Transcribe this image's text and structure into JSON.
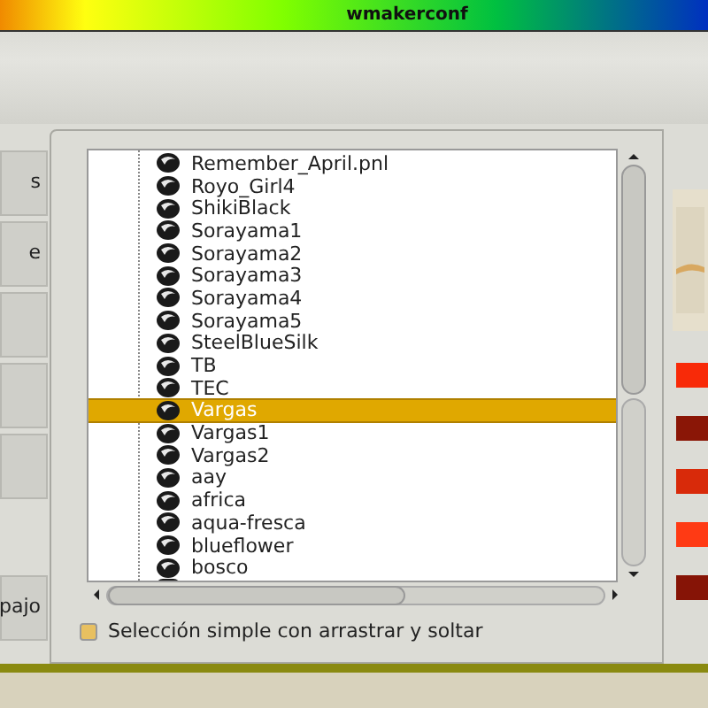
{
  "window": {
    "title": "wmakerconf"
  },
  "side_tabs": [
    {
      "label": "s"
    },
    {
      "label": "e"
    },
    {
      "label": "pajo"
    }
  ],
  "file_list": {
    "items": [
      {
        "name": "Remember_April.pnl",
        "selected": false
      },
      {
        "name": "Royo_Girl4",
        "selected": false
      },
      {
        "name": "ShikiBlack",
        "selected": false
      },
      {
        "name": "Sorayama1",
        "selected": false
      },
      {
        "name": "Sorayama2",
        "selected": false
      },
      {
        "name": "Sorayama3",
        "selected": false
      },
      {
        "name": "Sorayama4",
        "selected": false
      },
      {
        "name": "Sorayama5",
        "selected": false
      },
      {
        "name": "SteelBlueSilk",
        "selected": false
      },
      {
        "name": "TB",
        "selected": false
      },
      {
        "name": "TEC",
        "selected": false
      },
      {
        "name": "Vargas",
        "selected": true
      },
      {
        "name": "Vargas1",
        "selected": false
      },
      {
        "name": "Vargas2",
        "selected": false
      },
      {
        "name": "aay",
        "selected": false
      },
      {
        "name": "africa",
        "selected": false
      },
      {
        "name": "aqua-fresca",
        "selected": false
      },
      {
        "name": "blueflower",
        "selected": false
      },
      {
        "name": "bosco",
        "selected": false
      }
    ]
  },
  "drag_drop": {
    "label": "Selección simple con arrastrar y soltar",
    "checked": true
  },
  "swatches": [
    {
      "color": "#f82a08"
    },
    {
      "color": "#8a1606"
    },
    {
      "color": "#d82a0a"
    },
    {
      "color": "#ff3a14"
    },
    {
      "color": "#861406"
    }
  ]
}
